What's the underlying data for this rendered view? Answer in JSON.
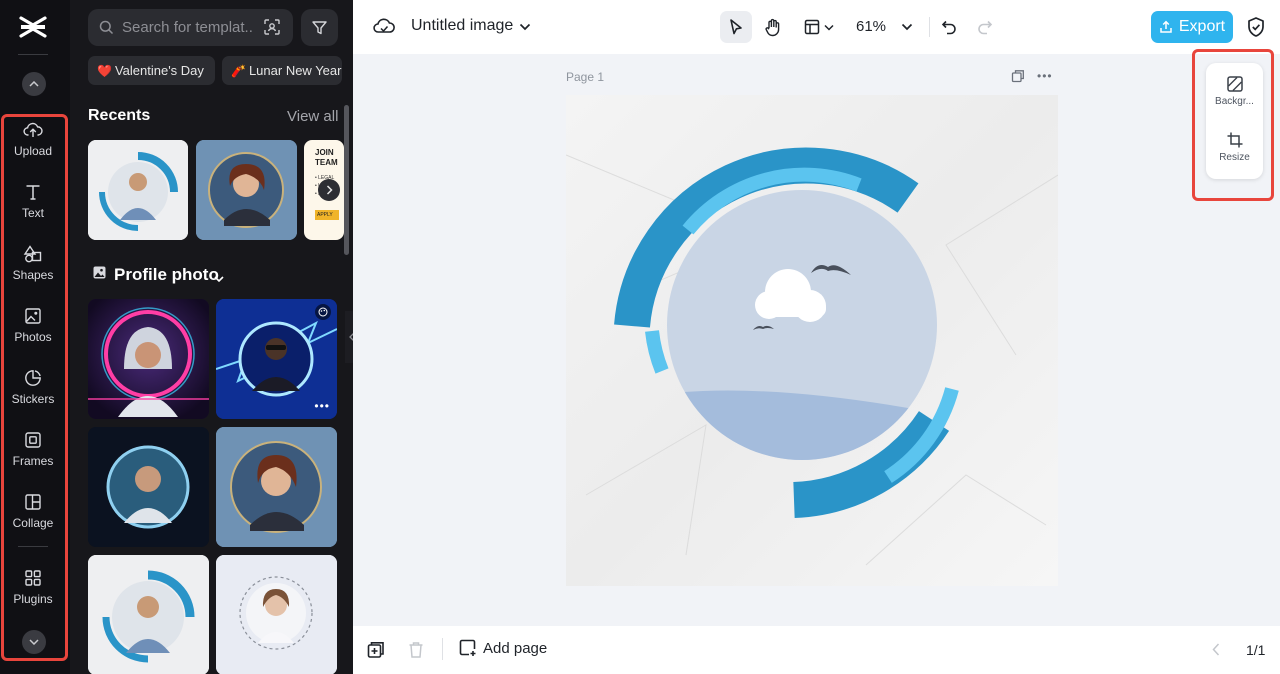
{
  "rail": {
    "items": [
      {
        "label": "Upload",
        "icon": "upload-cloud-icon"
      },
      {
        "label": "Text",
        "icon": "text-icon"
      },
      {
        "label": "Shapes",
        "icon": "shapes-icon"
      },
      {
        "label": "Photos",
        "icon": "photos-icon"
      },
      {
        "label": "Stickers",
        "icon": "stickers-icon"
      },
      {
        "label": "Frames",
        "icon": "frames-icon"
      },
      {
        "label": "Collage",
        "icon": "collage-icon"
      },
      {
        "label": "Plugins",
        "icon": "plugins-icon"
      }
    ]
  },
  "panel": {
    "search": {
      "placeholder": "Search for templat..."
    },
    "chips": [
      {
        "emoji": "❤️",
        "label": "Valentine's Day"
      },
      {
        "emoji": "🧨",
        "label": "Lunar New Year"
      }
    ],
    "recents": {
      "title": "Recents",
      "view_all": "View all"
    },
    "category": {
      "title": "Profile photo"
    },
    "promo_text": {
      "line1": "JOIN",
      "line2": "TEAM",
      "items": [
        "• LEGAL",
        "• LEARN",
        "• FLEXI"
      ],
      "button": "APPLY"
    }
  },
  "topbar": {
    "title": "Untitled image",
    "zoom": "61%",
    "export_label": "Export"
  },
  "canvas": {
    "page_label": "Page 1"
  },
  "side_panel": {
    "background_label": "Backgr...",
    "resize_label": "Resize"
  },
  "bottombar": {
    "add_page_label": "Add page",
    "page_count": "1/1"
  },
  "colors": {
    "accent": "#2fb4ee",
    "highlight_box": "#e8453c",
    "ring_dark": "#2a94c8",
    "ring_light": "#5bc4ef"
  }
}
